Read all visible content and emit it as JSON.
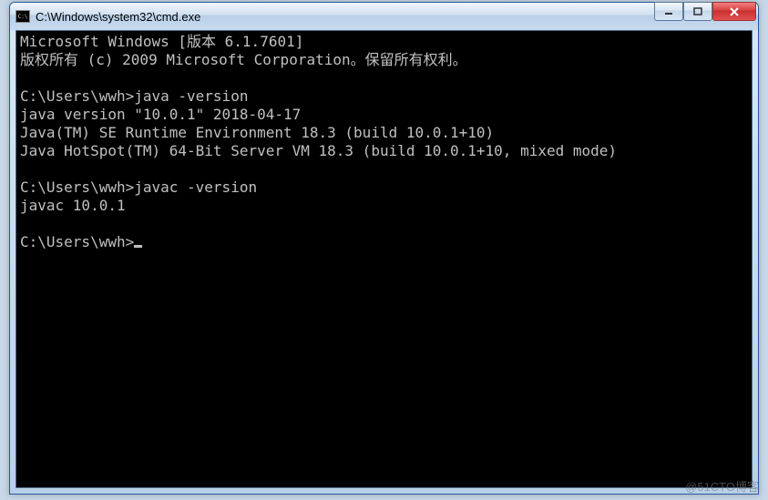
{
  "window": {
    "title": "C:\\Windows\\system32\\cmd.exe"
  },
  "console": {
    "lines": {
      "l0": "Microsoft Windows [版本 6.1.7601]",
      "l1": "版权所有 (c) 2009 Microsoft Corporation。保留所有权利。",
      "l2": "",
      "l3": "C:\\Users\\wwh>java -version",
      "l4": "java version \"10.0.1\" 2018-04-17",
      "l5": "Java(TM) SE Runtime Environment 18.3 (build 10.0.1+10)",
      "l6": "Java HotSpot(TM) 64-Bit Server VM 18.3 (build 10.0.1+10, mixed mode)",
      "l7": "",
      "l8": "C:\\Users\\wwh>javac -version",
      "l9": "javac 10.0.1",
      "l10": "",
      "l11": "C:\\Users\\wwh>"
    }
  },
  "watermark": "@51CTO博客"
}
